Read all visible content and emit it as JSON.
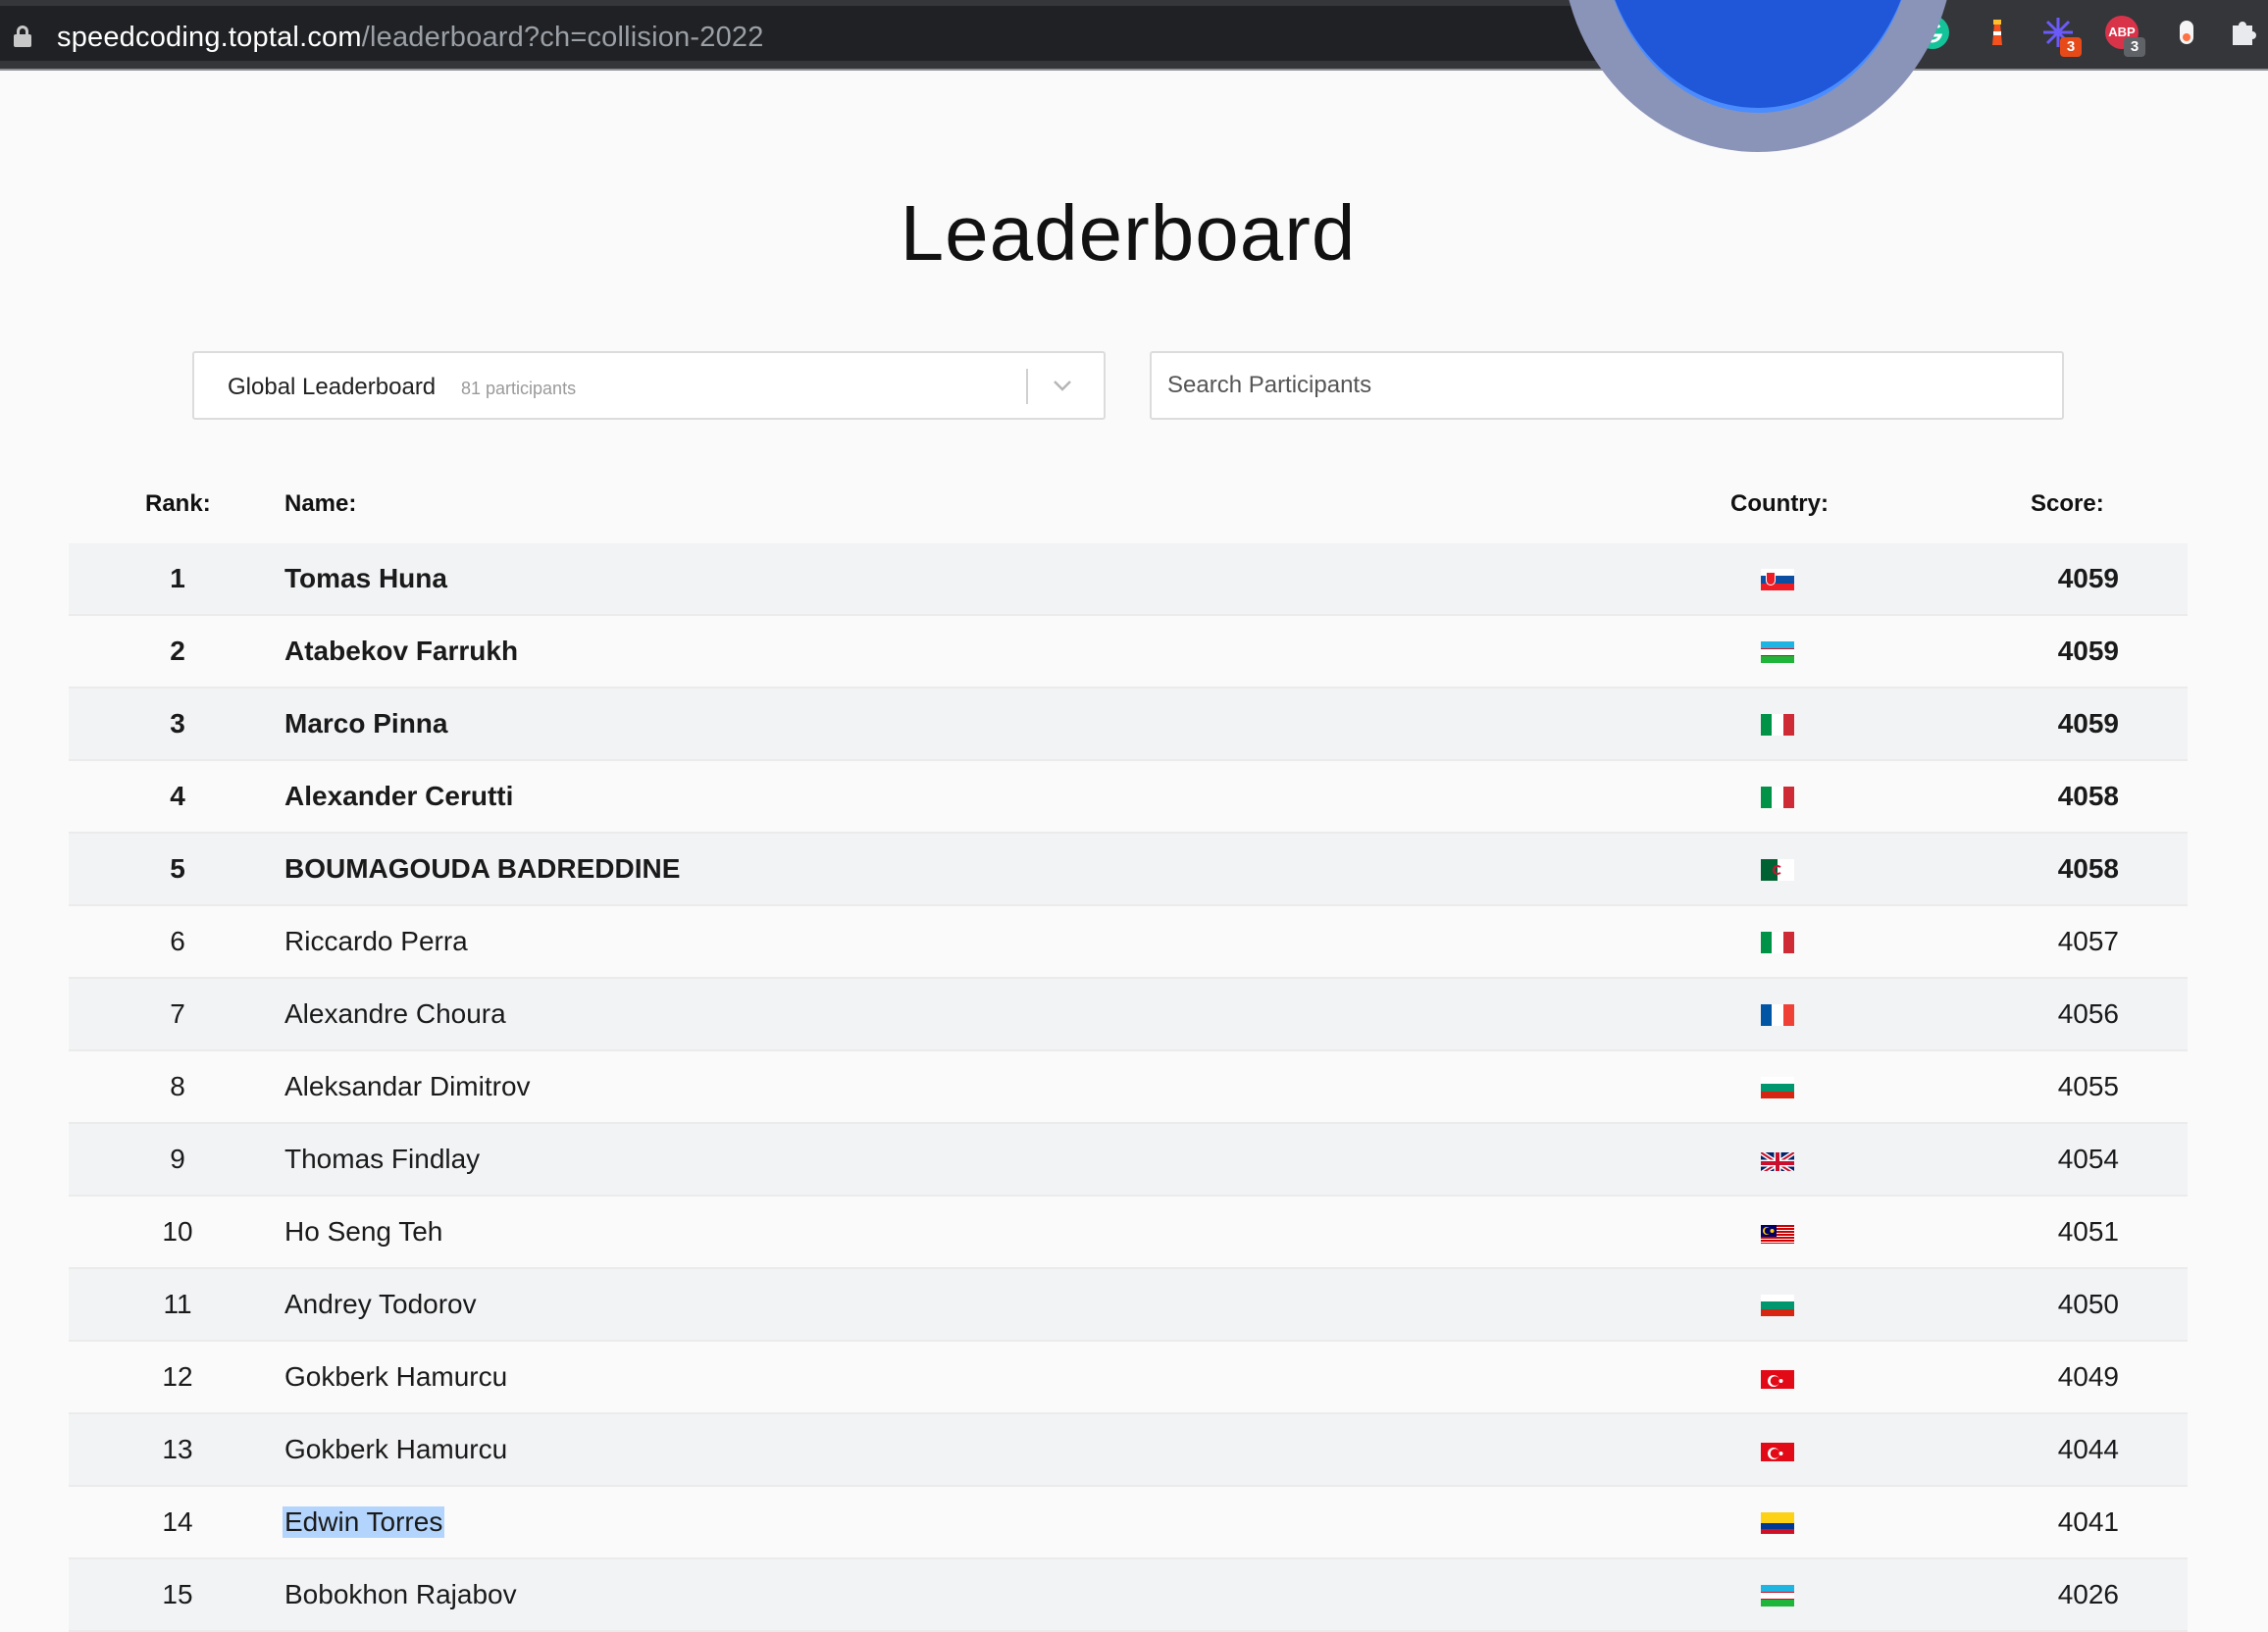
{
  "browser": {
    "url_host": "speedcoding.toptal.com",
    "url_path": "/leaderboard?ch=collision-2022",
    "extensions": [
      {
        "name": "translate-icon"
      },
      {
        "name": "zoom-icon"
      },
      {
        "name": "share-icon"
      },
      {
        "name": "bookmark-star-icon"
      },
      {
        "name": "grammarly-icon",
        "color": "#15c39a"
      },
      {
        "name": "lighthouse-icon",
        "color": "#f4511e"
      },
      {
        "name": "sparkle-extension-icon",
        "color": "#6a5af9",
        "badge": "3"
      },
      {
        "name": "adblock-icon",
        "color": "#d9334a",
        "label": "ABP",
        "badge": "3"
      },
      {
        "name": "extension-icon"
      },
      {
        "name": "puzzle-icon"
      }
    ]
  },
  "page": {
    "title": "Leaderboard",
    "leaderboard_select": {
      "label": "Global Leaderboard",
      "count": "81 participants"
    },
    "search": {
      "placeholder": "Search Participants"
    },
    "table": {
      "headers": {
        "rank": "Rank:",
        "name": "Name:",
        "country": "Country:",
        "score": "Score:"
      },
      "rows": [
        {
          "rank": "1",
          "name": "Tomas Huna",
          "country": "slovakia",
          "score": "4059",
          "bold": true
        },
        {
          "rank": "2",
          "name": "Atabekov Farrukh",
          "country": "uzbekistan",
          "score": "4059",
          "bold": true
        },
        {
          "rank": "3",
          "name": "Marco Pinna",
          "country": "italy",
          "score": "4059",
          "bold": true
        },
        {
          "rank": "4",
          "name": "Alexander Cerutti",
          "country": "italy",
          "score": "4058",
          "bold": true
        },
        {
          "rank": "5",
          "name": "BOUMAGOUDA BADREDDINE",
          "country": "algeria",
          "score": "4058",
          "bold": true
        },
        {
          "rank": "6",
          "name": "Riccardo Perra",
          "country": "italy",
          "score": "4057",
          "bold": false
        },
        {
          "rank": "7",
          "name": "Alexandre Choura",
          "country": "france",
          "score": "4056",
          "bold": false
        },
        {
          "rank": "8",
          "name": "Aleksandar Dimitrov",
          "country": "bulgaria",
          "score": "4055",
          "bold": false
        },
        {
          "rank": "9",
          "name": "Thomas Findlay",
          "country": "united-kingdom",
          "score": "4054",
          "bold": false
        },
        {
          "rank": "10",
          "name": "Ho Seng Teh",
          "country": "malaysia",
          "score": "4051",
          "bold": false
        },
        {
          "rank": "11",
          "name": "Andrey Todorov",
          "country": "bulgaria",
          "score": "4050",
          "bold": false
        },
        {
          "rank": "12",
          "name": "Gokberk Hamurcu",
          "country": "turkey",
          "score": "4049",
          "bold": false
        },
        {
          "rank": "13",
          "name": "Gokberk Hamurcu",
          "country": "turkey",
          "score": "4044",
          "bold": false
        },
        {
          "rank": "14",
          "name": "Edwin Torres",
          "country": "colombia",
          "score": "4041",
          "bold": false,
          "selected": true
        },
        {
          "rank": "15",
          "name": "Bobokhon Rajabov",
          "country": "uzbekistan",
          "score": "4026",
          "bold": false
        }
      ]
    }
  }
}
